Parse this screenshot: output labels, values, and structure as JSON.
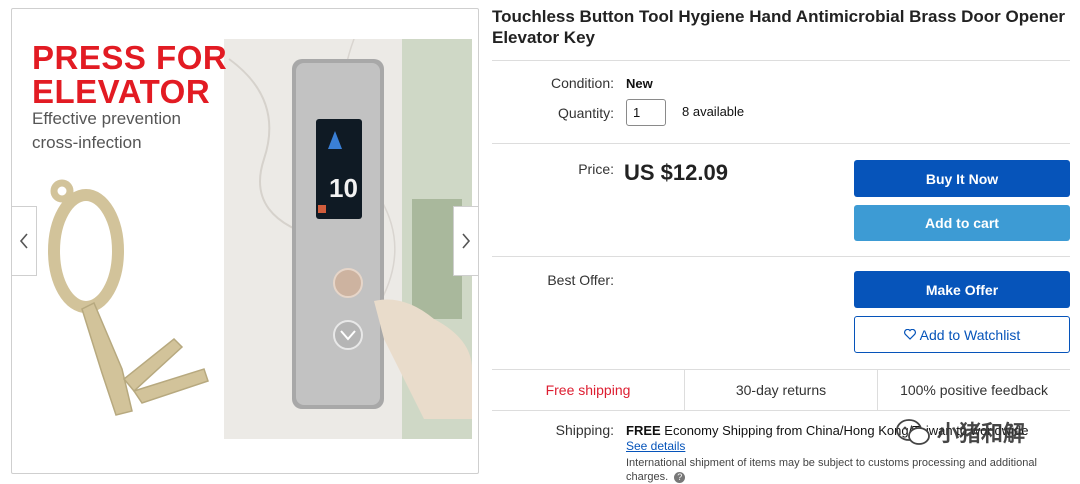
{
  "gallery": {
    "promo": {
      "line1": "PRESS FOR",
      "line2": "ELEVATOR",
      "line3": "Effective prevention",
      "line4": "cross-infection"
    },
    "elevator_floor": "10",
    "prev_icon": "chevron-left-icon",
    "next_icon": "chevron-right-icon"
  },
  "listing": {
    "title": "Touchless Button Tool Hygiene Hand Antimicrobial Brass Door Opener Elevator Key",
    "condition_label": "Condition:",
    "condition_value": "New",
    "quantity_label": "Quantity:",
    "quantity_value": "1",
    "available": "8 available",
    "price_label": "Price:",
    "price": "US $12.09",
    "best_offer_label": "Best Offer:"
  },
  "buttons": {
    "buy_now": "Buy It Now",
    "add_to_cart": "Add to cart",
    "make_offer": "Make Offer",
    "watchlist": "Add to Watchlist"
  },
  "features": [
    "Free shipping",
    "30-day returns",
    "100% positive feedback"
  ],
  "shipping": {
    "label": "Shipping:",
    "free": "FREE",
    "details": "Economy Shipping from China/Hong Kong/Taiwan to worldwide",
    "see_details": "See details",
    "note": "International shipment of items may be subject to customs processing and additional charges."
  },
  "watermark": {
    "text": "小猪和解",
    "icon": "wechat-icon"
  },
  "colors": {
    "primary_blue": "#0654ba",
    "cart_blue": "#3d9bd4",
    "free_shipping_red": "#dd1e31",
    "promo_red": "#e21b23"
  }
}
